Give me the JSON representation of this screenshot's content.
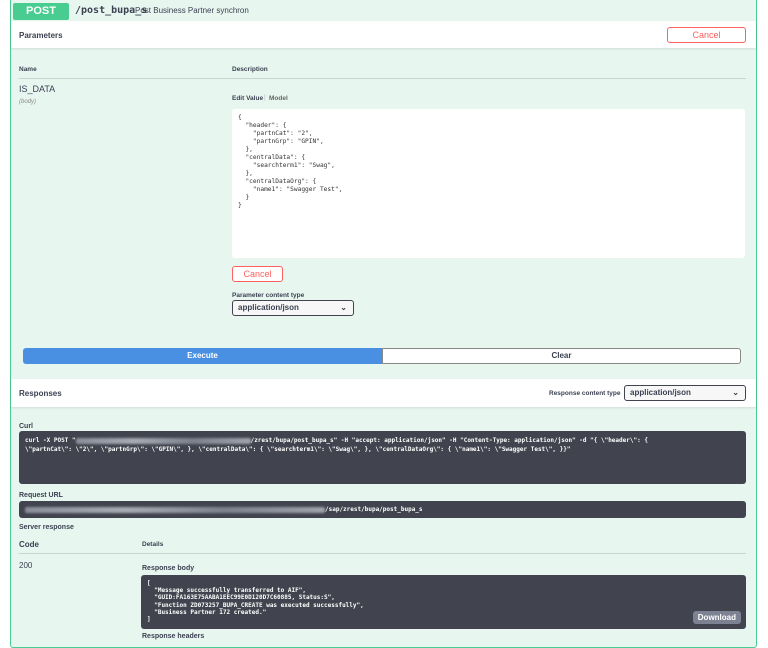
{
  "operation": {
    "method": "POST",
    "path": "/post_bupa_s",
    "summary": "Post Business Partner synchron"
  },
  "parameters": {
    "title": "Parameters",
    "cancel_label": "Cancel",
    "col_name": "Name",
    "col_description": "Description",
    "param_name": "IS_DATA",
    "param_in": "(body)",
    "tab_edit": "Edit Value",
    "tab_model": "Model",
    "body_value": "{\n  \"header\": {\n    \"partnCat\": \"2\",\n    \"partnGrp\": \"GPIN\",\n  },\n  \"centralData\": {\n    \"searchterm1\": \"Swag\",\n  },\n  \"centralDataOrg\": {\n    \"name1\": \"Swagger Test\",\n  }\n}",
    "cancel_inner_label": "Cancel",
    "content_type_label": "Parameter content type",
    "content_type": "application/json"
  },
  "actions": {
    "execute": "Execute",
    "clear": "Clear"
  },
  "responses": {
    "title": "Responses",
    "content_type_label": "Response content type",
    "content_type": "application/json",
    "curl_label": "Curl",
    "curl_prefix": "curl -X POST \"",
    "curl_rest": "/zrest/bupa/post_bupa_s\" -H \"accept: application/json\" -H \"Content-Type: application/json\" -d \"{ \\\"header\\\": {",
    "curl_line2": "\\\"partnCat\\\": \\\"2\\\", \\\"partnGrp\\\": \\\"GPIN\\\", }, \\\"centralData\\\": { \\\"searchterm1\\\": \\\"Swag\\\", }, \\\"centralDataOrg\\\": { \\\"name1\\\": \\\"Swagger Test\\\", }}\"",
    "request_url_label": "Request URL",
    "request_url_rest": "/sap/zrest/bupa/post_bupa_s",
    "server_response_label": "Server response",
    "col_code": "Code",
    "col_details": "Details",
    "code": "200",
    "body_label": "Response body",
    "body": "[\n  \"Message successfully transferred to AIF\",\n  \"GUID:FA163E75AABA1EEC99E0D120D7C60885, Status:S\",\n  \"Function ZD073257_BUPA_CREATE was executed successfully\",\n  \"Business Partner 172 created.\"\n]",
    "download": "Download",
    "headers_label": "Response headers"
  }
}
